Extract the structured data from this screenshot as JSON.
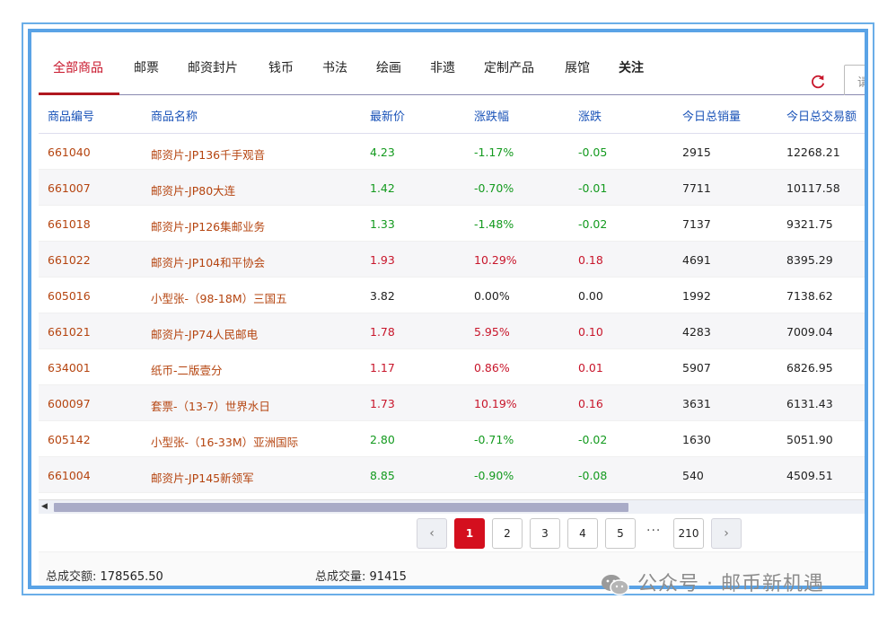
{
  "tabs": [
    {
      "label": "全部商品",
      "active": true
    },
    {
      "label": "邮票"
    },
    {
      "label": "邮资封片"
    },
    {
      "label": "钱币"
    },
    {
      "label": "书法"
    },
    {
      "label": "绘画"
    },
    {
      "label": "非遗"
    },
    {
      "label": "定制产品"
    },
    {
      "label": "展馆"
    },
    {
      "label": "关注",
      "bold": true
    }
  ],
  "search": {
    "placeholder": "请"
  },
  "columns": [
    "商品编号",
    "商品名称",
    "最新价",
    "涨跌幅",
    "涨跌",
    "今日总销量",
    "今日总交易额"
  ],
  "rows": [
    {
      "code": "661040",
      "name": "邮资片-JP136千手观音",
      "price": "4.23",
      "pct": "-1.17%",
      "change": "-0.05",
      "volume": "2915",
      "amount": "12268.21",
      "trend": "down"
    },
    {
      "code": "661007",
      "name": "邮资片-JP80大连",
      "price": "1.42",
      "pct": "-0.70%",
      "change": "-0.01",
      "volume": "7711",
      "amount": "10117.58",
      "trend": "down"
    },
    {
      "code": "661018",
      "name": "邮资片-JP126集邮业务",
      "price": "1.33",
      "pct": "-1.48%",
      "change": "-0.02",
      "volume": "7137",
      "amount": "9321.75",
      "trend": "down"
    },
    {
      "code": "661022",
      "name": "邮资片-JP104和平协会",
      "price": "1.93",
      "pct": "10.29%",
      "change": "0.18",
      "volume": "4691",
      "amount": "8395.29",
      "trend": "up"
    },
    {
      "code": "605016",
      "name": "小型张-（98-18M）三国五",
      "price": "3.82",
      "pct": "0.00%",
      "change": "0.00",
      "volume": "1992",
      "amount": "7138.62",
      "trend": "flat"
    },
    {
      "code": "661021",
      "name": "邮资片-JP74人民邮电",
      "price": "1.78",
      "pct": "5.95%",
      "change": "0.10",
      "volume": "4283",
      "amount": "7009.04",
      "trend": "up"
    },
    {
      "code": "634001",
      "name": "纸币-二版壹分",
      "price": "1.17",
      "pct": "0.86%",
      "change": "0.01",
      "volume": "5907",
      "amount": "6826.95",
      "trend": "up"
    },
    {
      "code": "600097",
      "name": "套票-（13-7）世界水日",
      "price": "1.73",
      "pct": "10.19%",
      "change": "0.16",
      "volume": "3631",
      "amount": "6131.43",
      "trend": "up"
    },
    {
      "code": "605142",
      "name": "小型张-（16-33M）亚洲国际",
      "price": "2.80",
      "pct": "-0.71%",
      "change": "-0.02",
      "volume": "1630",
      "amount": "5051.90",
      "trend": "down"
    },
    {
      "code": "661004",
      "name": "邮资片-JP145新领军",
      "price": "8.85",
      "pct": "-0.90%",
      "change": "-0.08",
      "volume": "540",
      "amount": "4509.51",
      "trend": "down"
    }
  ],
  "pagination": {
    "pages": [
      "1",
      "2",
      "3",
      "4",
      "5"
    ],
    "ellipsis": "···",
    "last": "210",
    "prev": "‹",
    "next": "›"
  },
  "footer": {
    "total_amount_label": "总成交额:",
    "total_amount": "178565.50",
    "total_volume_label": "总成交量:",
    "total_volume": "91415"
  },
  "watermark": "公众号 · 邮币新机遇",
  "colors": {
    "up": "#c8162b",
    "down": "#139a1e",
    "accent": "#d40f1e",
    "header": "#1a53b8",
    "code": "#b5440f"
  }
}
